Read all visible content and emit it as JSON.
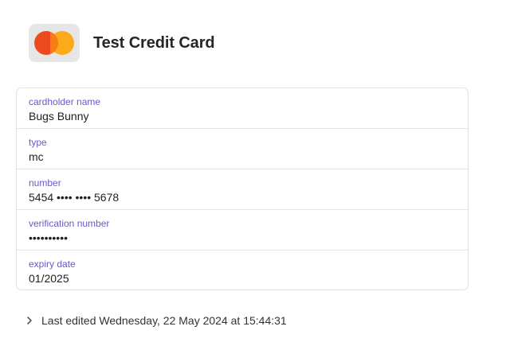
{
  "header": {
    "title": "Test Credit Card",
    "logo_icon": "mastercard-icon"
  },
  "fields": [
    {
      "label": "cardholder name",
      "value": "Bugs Bunny"
    },
    {
      "label": "type",
      "value": "mc"
    },
    {
      "label": "number",
      "value": "5454 •••• •••• 5678"
    },
    {
      "label": "verification number",
      "value": "••••••••••"
    },
    {
      "label": "expiry date",
      "value": "01/2025"
    }
  ],
  "footer": {
    "chevron_icon": "chevron-right-icon",
    "text": "Last edited Wednesday, 22 May 2024 at 15:44:31"
  },
  "colors": {
    "label": "#6b57c9",
    "mc_red": "#ee4a1f",
    "mc_yellow": "#fbab1a"
  }
}
